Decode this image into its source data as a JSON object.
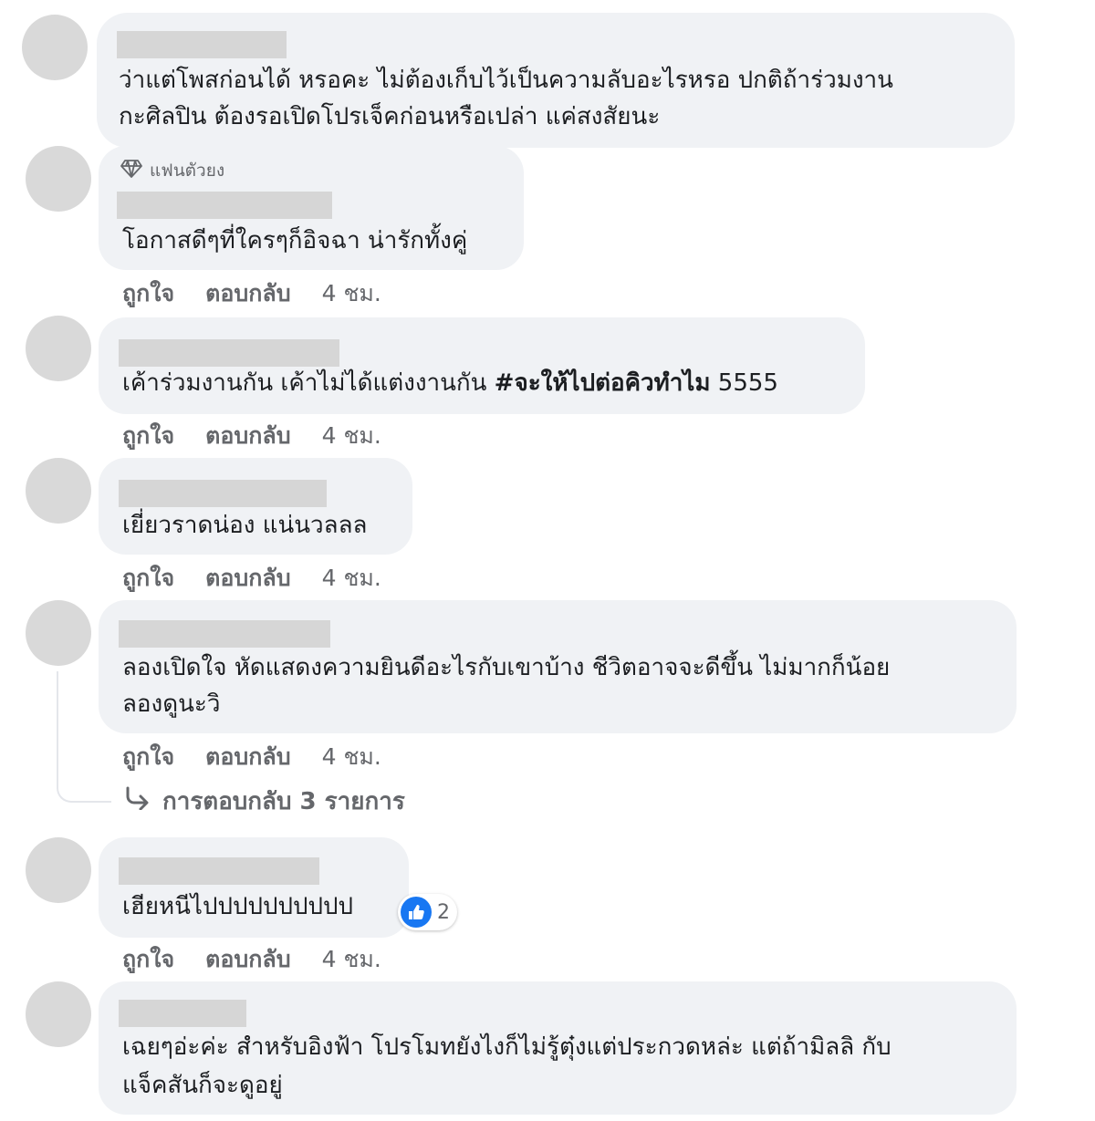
{
  "comments": [
    {
      "lines": [
        "ว่าแต่โพสก่อนได้ หรอคะ ไม่ต้องเก็บไว้เป็นความลับอะไรหรอ ปกติถ้าร่วมงาน",
        "กะศิลปิน ต้องรอเปิดโปรเจ็คก่อนหรือเปล่า แค่สงสัยนะ"
      ]
    },
    {
      "badge": "แฟนตัวยง",
      "lines": [
        "โอกาสดีๆที่ใครๆก็อิจฉา น่ารักทั้งคู่"
      ],
      "like": "ถูกใจ",
      "reply": "ตอบกลับ",
      "time": "4 ชม."
    },
    {
      "line_normal": "เค้าร่วมงานกัน เค้าไม่ได้แต่งงานกัน ",
      "hashtag": "#จะให้ไปต่อคิวทำไม",
      "line_tail": " 5555",
      "like": "ถูกใจ",
      "reply": "ตอบกลับ",
      "time": "4 ชม."
    },
    {
      "lines": [
        "เยี่ยวราดน่อง แน่นวลลล"
      ],
      "like": "ถูกใจ",
      "reply": "ตอบกลับ",
      "time": "4 ชม."
    },
    {
      "lines": [
        "ลองเปิดใจ หัดแสดงความยินดีอะไรกับเขาบ้าง ชีวิตอาจจะดีขึ้น ไม่มากก็น้อย",
        "ลองดูนะวิ"
      ],
      "like": "ถูกใจ",
      "reply": "ตอบกลับ",
      "time": "4 ชม.",
      "replies_label": "การตอบกลับ 3 รายการ"
    },
    {
      "lines": [
        "เฮียหนีไปปปปปปปปปป"
      ],
      "reaction_count": "2",
      "like": "ถูกใจ",
      "reply": "ตอบกลับ",
      "time": "4 ชม."
    },
    {
      "lines": [
        "เฉยๆอ่ะค่ะ สำหรับอิงฟ้า โปรโมทยังไงก็ไม่รู้ตุ๋งแต่ประกวดหล่ะ แต่ถ้ามิลลิ กับ",
        "แจ็คสันก็จะดูอยู่"
      ]
    }
  ],
  "icons": {
    "badge": "diamond-icon",
    "reply_arrow": "reply-arrow-icon",
    "reaction": "thumbs-up-icon"
  },
  "colors": {
    "bubble": "#f0f2f5",
    "reaction_blue": "#1877f2",
    "muted_text": "#65676b"
  }
}
